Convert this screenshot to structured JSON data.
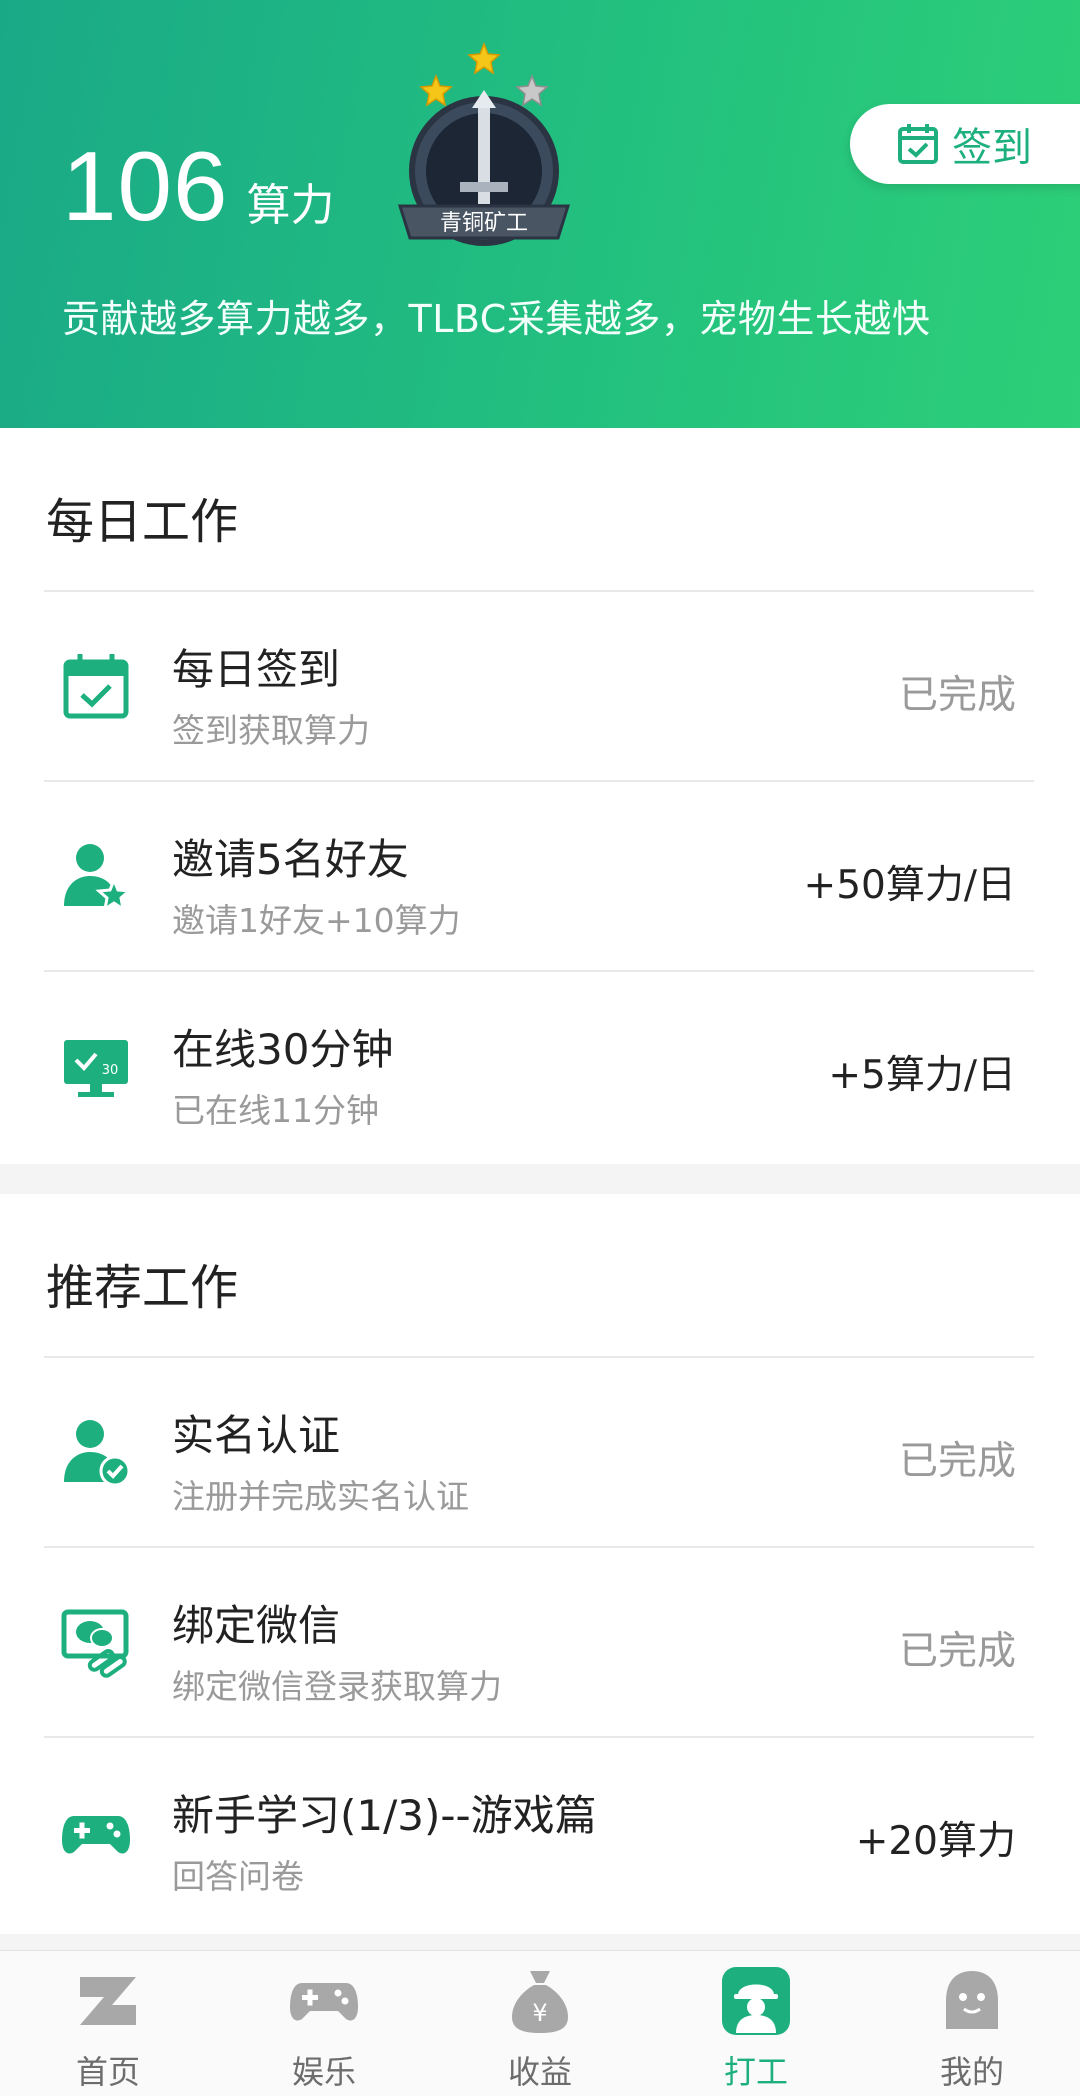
{
  "header": {
    "points_value": "106",
    "points_unit": "算力",
    "badge_text": "青铜矿工",
    "checkin_label": "签到",
    "slogan": "贡献越多算力越多，TLBC采集越多，宠物生长越快"
  },
  "daily": {
    "title": "每日工作",
    "items": [
      {
        "title": "每日签到",
        "subtitle": "签到获取算力",
        "status": "已完成",
        "icon": "calendar-check-icon"
      },
      {
        "title": "邀请5名好友",
        "subtitle": "邀请1好友+10算力",
        "status": "+50算力/日",
        "icon": "user-star-icon"
      },
      {
        "title": "在线30分钟",
        "subtitle": "已在线11分钟",
        "status": "+5算力/日",
        "icon": "monitor-clock-icon"
      }
    ]
  },
  "recommended": {
    "title": "推荐工作",
    "items": [
      {
        "title": "实名认证",
        "subtitle": "注册并完成实名认证",
        "status": "已完成",
        "icon": "user-verified-icon"
      },
      {
        "title": "绑定微信",
        "subtitle": "绑定微信登录获取算力",
        "status": "已完成",
        "icon": "wechat-link-icon"
      },
      {
        "title": "新手学习(1/3)--游戏篇",
        "subtitle": "回答问卷",
        "status": "+20算力",
        "icon": "gamepad-icon"
      }
    ]
  },
  "tabs": [
    {
      "label": "首页",
      "icon": "home-z-icon"
    },
    {
      "label": "娱乐",
      "icon": "gamepad-icon"
    },
    {
      "label": "收益",
      "icon": "money-bag-icon"
    },
    {
      "label": "打工",
      "icon": "worker-icon",
      "active": true
    },
    {
      "label": "我的",
      "icon": "profile-face-icon"
    }
  ],
  "colors": {
    "accent": "#1db07e",
    "header_start": "#1aa987",
    "header_end": "#2dcf78",
    "muted": "#9a9a9a"
  }
}
